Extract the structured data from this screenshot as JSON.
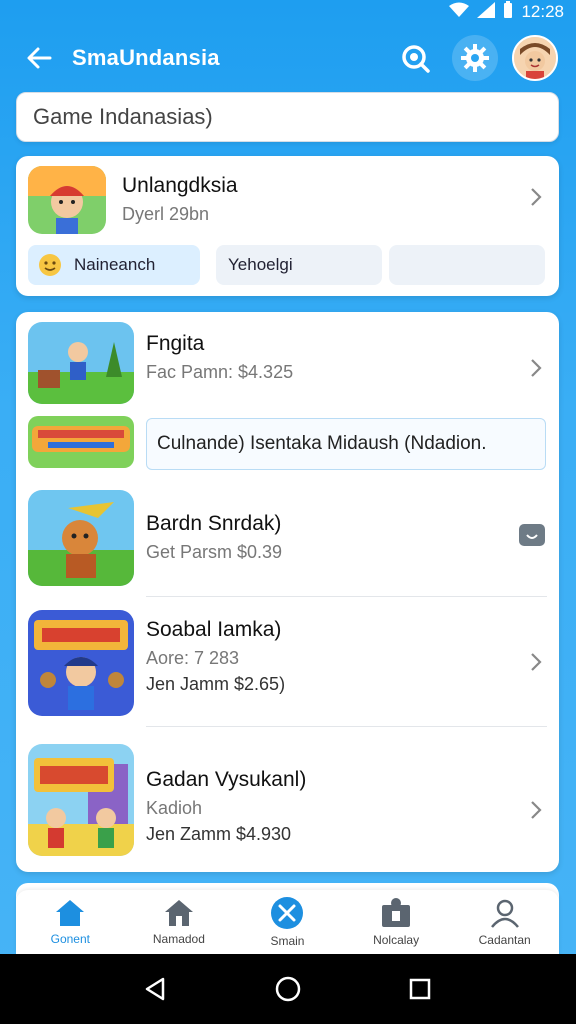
{
  "status_bar": {
    "time": "12:28"
  },
  "app_bar": {
    "title": "SmaUndansia"
  },
  "search": {
    "placeholder": "Game Indanasias)"
  },
  "featured": {
    "title": "Unlangdksia",
    "subtitle": "Dyerl 29bn",
    "chips": [
      "Naineanch",
      "Yehoelgi",
      ""
    ]
  },
  "list": {
    "items": [
      {
        "title": "Fngita",
        "line1": "Fac Pamn: $4.325",
        "line2": ""
      },
      {
        "title": "Bardn Snrdak)",
        "line1": "Get Parsm $0.39",
        "line2": ""
      },
      {
        "title": "Soabal Iamka)",
        "line1": "Aore: 7 283",
        "line2": "Jen Jamm $2.65)"
      },
      {
        "title": "Gadan Vysukanl)",
        "line1": "Kadioh",
        "line2": "Jen Zamm $4.930"
      }
    ],
    "banner_text": "Culnande) Isentaka Midaush (Ndadion."
  },
  "bottom_nav": {
    "items": [
      {
        "label": "Gonent",
        "icon": "home-icon"
      },
      {
        "label": "Namadod",
        "icon": "house-icon"
      },
      {
        "label": "Smain",
        "icon": "close-circle-icon"
      },
      {
        "label": "Nolcalay",
        "icon": "person-board-icon"
      },
      {
        "label": "Cadantan",
        "icon": "user-icon"
      }
    ]
  },
  "colors": {
    "primary": "#1e9ef0",
    "active": "#1d8fe0"
  }
}
